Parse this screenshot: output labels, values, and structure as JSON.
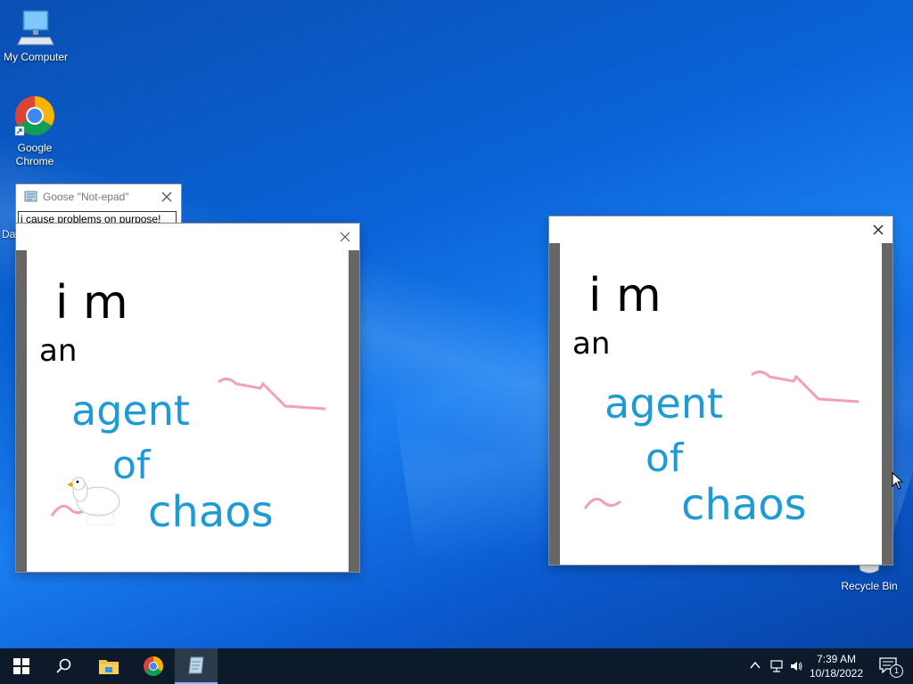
{
  "desktop": {
    "icons": [
      {
        "label": "My Computer"
      },
      {
        "label": "Google Chrome"
      },
      {
        "label": "Recycle Bin"
      },
      {
        "label": "Da"
      }
    ]
  },
  "notepad": {
    "title": "Goose \"Not-epad\"",
    "text": "i cause problems on purpose!"
  },
  "left_note": {
    "lines": [
      "i m",
      "an",
      "agent",
      "of",
      "chaos"
    ]
  },
  "right_note": {
    "lines": [
      "i m",
      "an",
      "agent",
      "of",
      "chaos"
    ]
  },
  "taskbar": {
    "time": "7:39 AM",
    "date": "10/18/2022",
    "notification_count": "1"
  },
  "colors": {
    "ink_black": "#000000",
    "ink_blue": "#1e9ad6",
    "ink_pink": "#f2a0b8",
    "taskbar": "#0c1a2b"
  }
}
